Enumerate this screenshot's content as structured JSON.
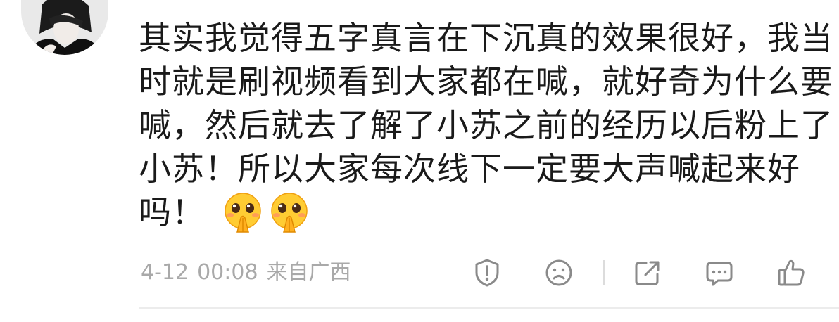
{
  "comment": {
    "lines": [
      "其实我觉得五字真言在下沉真的效果很好，我当",
      "时就是刷视频看到大家都在喊，就好奇为什么要",
      "喊，然后就去了解了小苏之前的经历以后粉上了",
      "小苏！所以大家每次线下一定要大声喊起来好",
      "吗！"
    ],
    "emojis": [
      "pleading-face-icon",
      "pleading-face-icon"
    ]
  },
  "meta": {
    "date": "4-12",
    "time": "00:08",
    "location": "来自广西"
  },
  "actions": {
    "report": "report-icon",
    "dislike": "frown-face-icon",
    "share": "share-icon",
    "reply": "comment-icon",
    "like": "thumbs-up-icon"
  },
  "colors": {
    "text": "#1a1a1a",
    "meta": "#a9a9a9",
    "icon": "#8a8a8a",
    "divider": "#ececec"
  }
}
